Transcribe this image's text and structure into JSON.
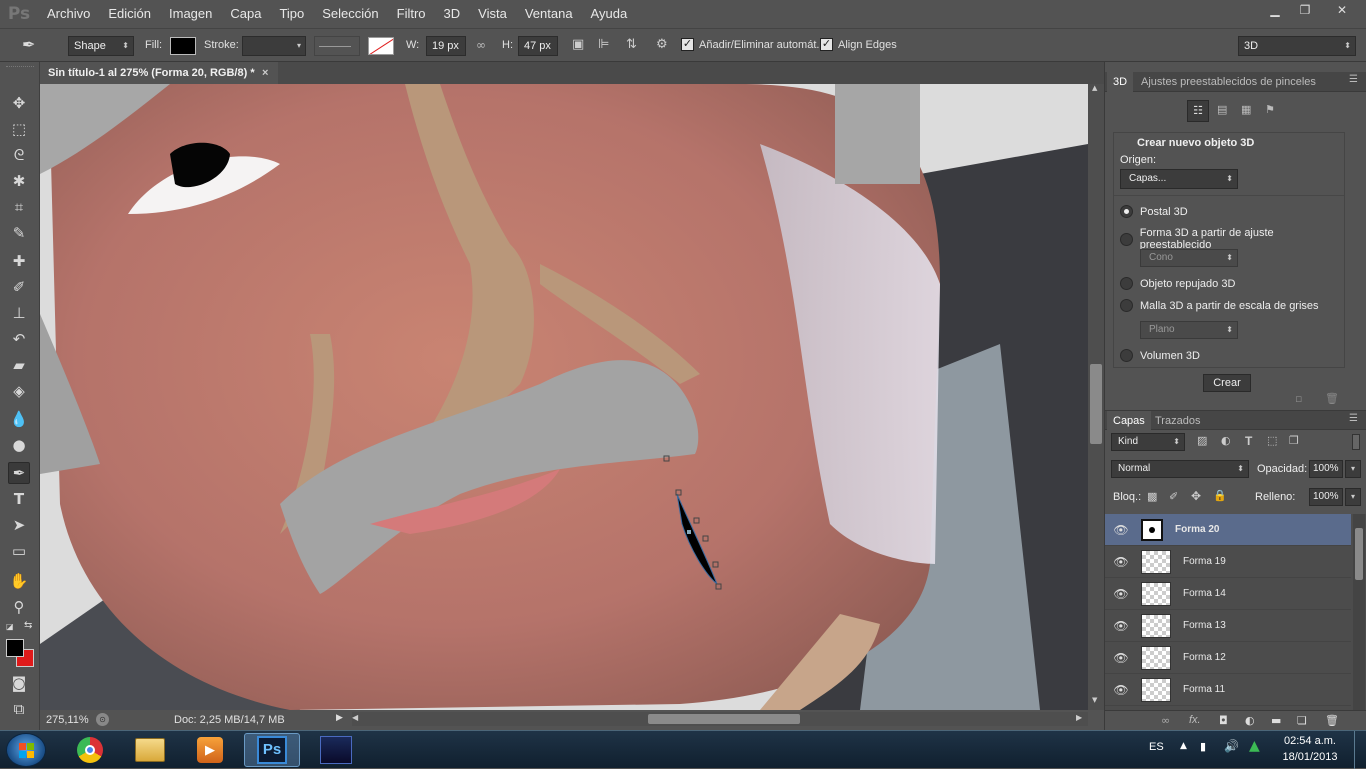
{
  "app": {
    "logo": "Ps",
    "menus": [
      "Archivo",
      "Edición",
      "Imagen",
      "Capa",
      "Tipo",
      "Selección",
      "Filtro",
      "3D",
      "Vista",
      "Ventana",
      "Ayuda"
    ]
  },
  "options": {
    "mode": "Shape",
    "fill_label": "Fill:",
    "stroke_label": "Stroke:",
    "w_label": "W:",
    "w_value": "19 px",
    "h_label": "H:",
    "h_value": "47 px",
    "auto_add_label": "Añadir/Eliminar automát.",
    "align_edges_label": "Align Edges",
    "workspace": "3D"
  },
  "document": {
    "tab_title": "Sin título-1 al 275% (Forma 20, RGB/8) *",
    "zoom": "275,11%",
    "doc_info": "Doc: 2,25 MB/14,7 MB"
  },
  "panel3d": {
    "tabs": [
      "3D",
      "Ajustes preestablecidos de pinceles"
    ],
    "section_title": "Crear nuevo objeto 3D",
    "origin_label": "Origen:",
    "origin_value": "Capas...",
    "options": [
      {
        "label": "Postal 3D",
        "selected": true
      },
      {
        "label": "Forma 3D a partir de ajuste preestablecido",
        "selected": false
      },
      {
        "label": "Objeto repujado 3D",
        "selected": false
      },
      {
        "label": "Malla 3D a partir de escala de grises",
        "selected": false
      },
      {
        "label": "Volumen 3D",
        "selected": false
      }
    ],
    "preset_value": "Cono",
    "grayscale_value": "Plano",
    "create_button": "Crear"
  },
  "layers": {
    "tabs": [
      "Capas",
      "Trazados"
    ],
    "filter": "Kind",
    "blend_mode": "Normal",
    "opacity_label": "Opacidad:",
    "opacity_value": "100%",
    "lock_label": "Bloq.:",
    "fill_label": "Relleno:",
    "fill_value": "100%",
    "items": [
      {
        "name": "Forma 20",
        "selected": true
      },
      {
        "name": "Forma 19",
        "selected": false
      },
      {
        "name": "Forma 14",
        "selected": false
      },
      {
        "name": "Forma 13",
        "selected": false
      },
      {
        "name": "Forma 12",
        "selected": false
      },
      {
        "name": "Forma 11",
        "selected": false
      }
    ]
  },
  "taskbar": {
    "language": "ES",
    "time": "02:54 a.m.",
    "date": "18/01/2013",
    "ps_label": "Ps"
  },
  "colors": {
    "foreground": "#000000",
    "background": "#e01a1a",
    "selected_layer": "#5a6b8c"
  }
}
